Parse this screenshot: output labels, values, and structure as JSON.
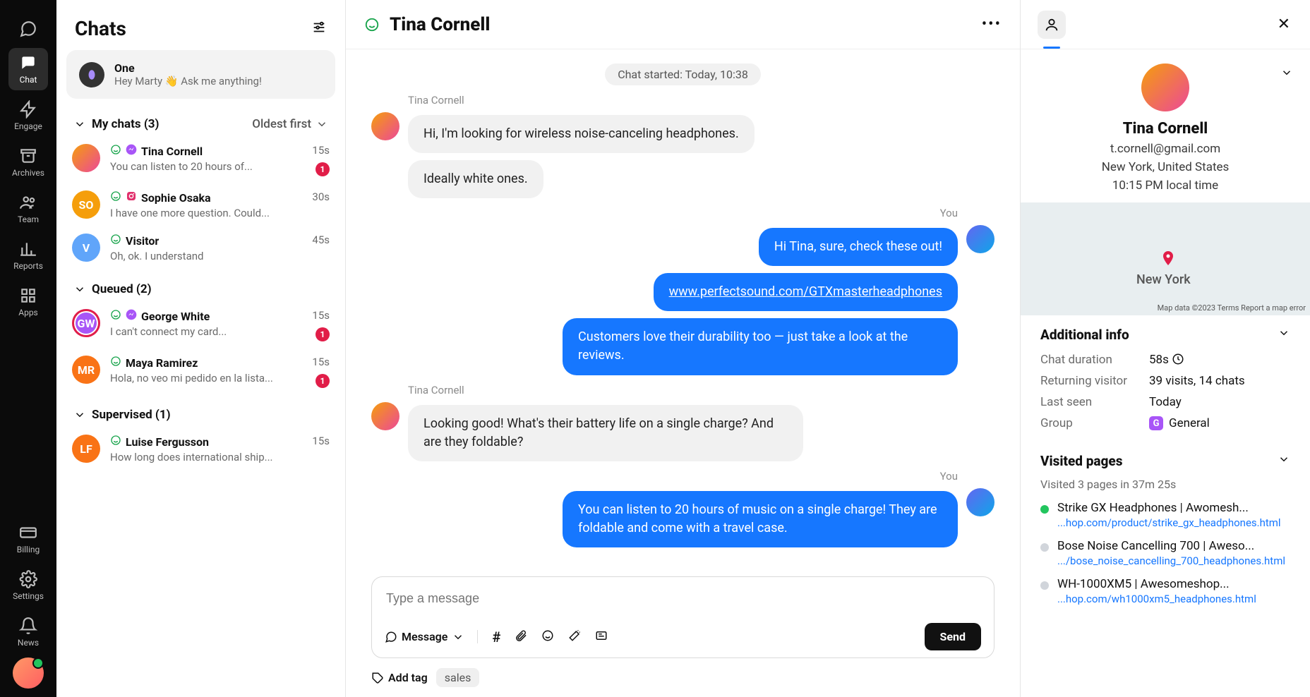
{
  "rail": {
    "items": [
      {
        "id": "speech",
        "label": ""
      },
      {
        "id": "chat",
        "label": "Chat"
      },
      {
        "id": "engage",
        "label": "Engage"
      },
      {
        "id": "archives",
        "label": "Archives"
      },
      {
        "id": "team",
        "label": "Team"
      },
      {
        "id": "reports",
        "label": "Reports"
      },
      {
        "id": "apps",
        "label": "Apps"
      }
    ],
    "bottom": [
      {
        "id": "billing",
        "label": "Billing"
      },
      {
        "id": "settings",
        "label": "Settings"
      },
      {
        "id": "news",
        "label": "News"
      }
    ]
  },
  "list": {
    "title": "Chats",
    "one": {
      "title": "One",
      "subtitle": "Hey Marty 👋 Ask me anything!"
    },
    "sections": {
      "my": {
        "label": "My chats (3)",
        "sort": "Oldest first"
      },
      "queued": {
        "label": "Queued (2)"
      },
      "supervised": {
        "label": "Supervised (1)"
      }
    },
    "my_chats": [
      {
        "name": "Tina Cornell",
        "preview": "You can listen to 20 hours of...",
        "time": "15s",
        "badge": "1",
        "source": "messenger",
        "avatar": "img"
      },
      {
        "name": "Sophie Osaka",
        "preview": "I have one more question. Could...",
        "time": "30s",
        "badge": "",
        "source": "instagram",
        "avatar": "SO",
        "color": "#f59e0b"
      },
      {
        "name": "Visitor",
        "preview": "Oh, ok. I understand",
        "time": "45s",
        "badge": "",
        "source": "",
        "avatar": "V",
        "color": "#60a5fa"
      }
    ],
    "queued": [
      {
        "name": "George White",
        "preview": "I can't connect my card...",
        "time": "15s",
        "badge": "1",
        "source": "messenger",
        "avatar": "GW",
        "color": "#a855f7",
        "ring": true
      },
      {
        "name": "Maya Ramirez",
        "preview": "Hola, no veo mi pedido en la lista...",
        "time": "15s",
        "badge": "1",
        "source": "",
        "avatar": "MR",
        "color": "#f97316"
      }
    ],
    "supervised": [
      {
        "name": "Luise  Fergusson",
        "preview": "How long does international ship...",
        "time": "15s",
        "badge": "",
        "source": "",
        "avatar": "LF",
        "color": "#f97316"
      }
    ]
  },
  "conv": {
    "name": "Tina Cornell",
    "start_chip": "Chat started: Today, 10:38",
    "thread": [
      {
        "who": "Tina Cornell",
        "side": "in",
        "bubbles": [
          "Hi, I'm looking for wireless noise-canceling headphones.",
          "Ideally white ones."
        ]
      },
      {
        "who": "You",
        "side": "out",
        "bubbles": [
          "Hi Tina, sure, check these out!",
          "www.perfectsound.com/GTXmasterheadphones",
          "Customers love their durability too — just take a look at the reviews."
        ],
        "link_index": 1
      },
      {
        "who": "Tina Cornell",
        "side": "in",
        "bubbles": [
          "Looking good! What's their battery life on a single charge? And are they foldable?"
        ]
      },
      {
        "who": "You",
        "side": "out",
        "bubbles": [
          "You can listen to 20 hours of music on a single charge! They are foldable and come with a travel case."
        ]
      }
    ],
    "composer": {
      "placeholder": "Type a message",
      "button": "Message",
      "send": "Send"
    },
    "tags": {
      "add": "Add tag",
      "items": [
        "sales"
      ]
    }
  },
  "info": {
    "name": "Tina Cornell",
    "email": "t.cornell@gmail.com",
    "location": "New York, United States",
    "localtime": "10:15 PM local time",
    "map": {
      "city": "New York",
      "terms": "Map data ©2023 Terms   Report a map error"
    },
    "additional": {
      "title": "Additional info",
      "rows": {
        "duration": {
          "k": "Chat duration",
          "v": "58s"
        },
        "returning": {
          "k": "Returning visitor",
          "v": "39 visits, 14 chats"
        },
        "lastseen": {
          "k": "Last seen",
          "v": "Today"
        },
        "group": {
          "k": "Group",
          "v": "General"
        }
      }
    },
    "visited": {
      "title": "Visited pages",
      "summary": "Visited 3 pages in 37m 25s",
      "pages": [
        {
          "active": true,
          "title": "Strike GX Headphones | Awomesh...",
          "url": "...hop.com/product/strike_gx_headphones.html"
        },
        {
          "active": false,
          "title": "Bose Noise Cancelling 700 | Aweso...",
          "url": ".../bose_noise_cancelling_700_headphones.html"
        },
        {
          "active": false,
          "title": "WH-1000XM5 | Awesomeshop...",
          "url": "...hop.com/wh1000xm5_headphones.html"
        }
      ]
    }
  }
}
